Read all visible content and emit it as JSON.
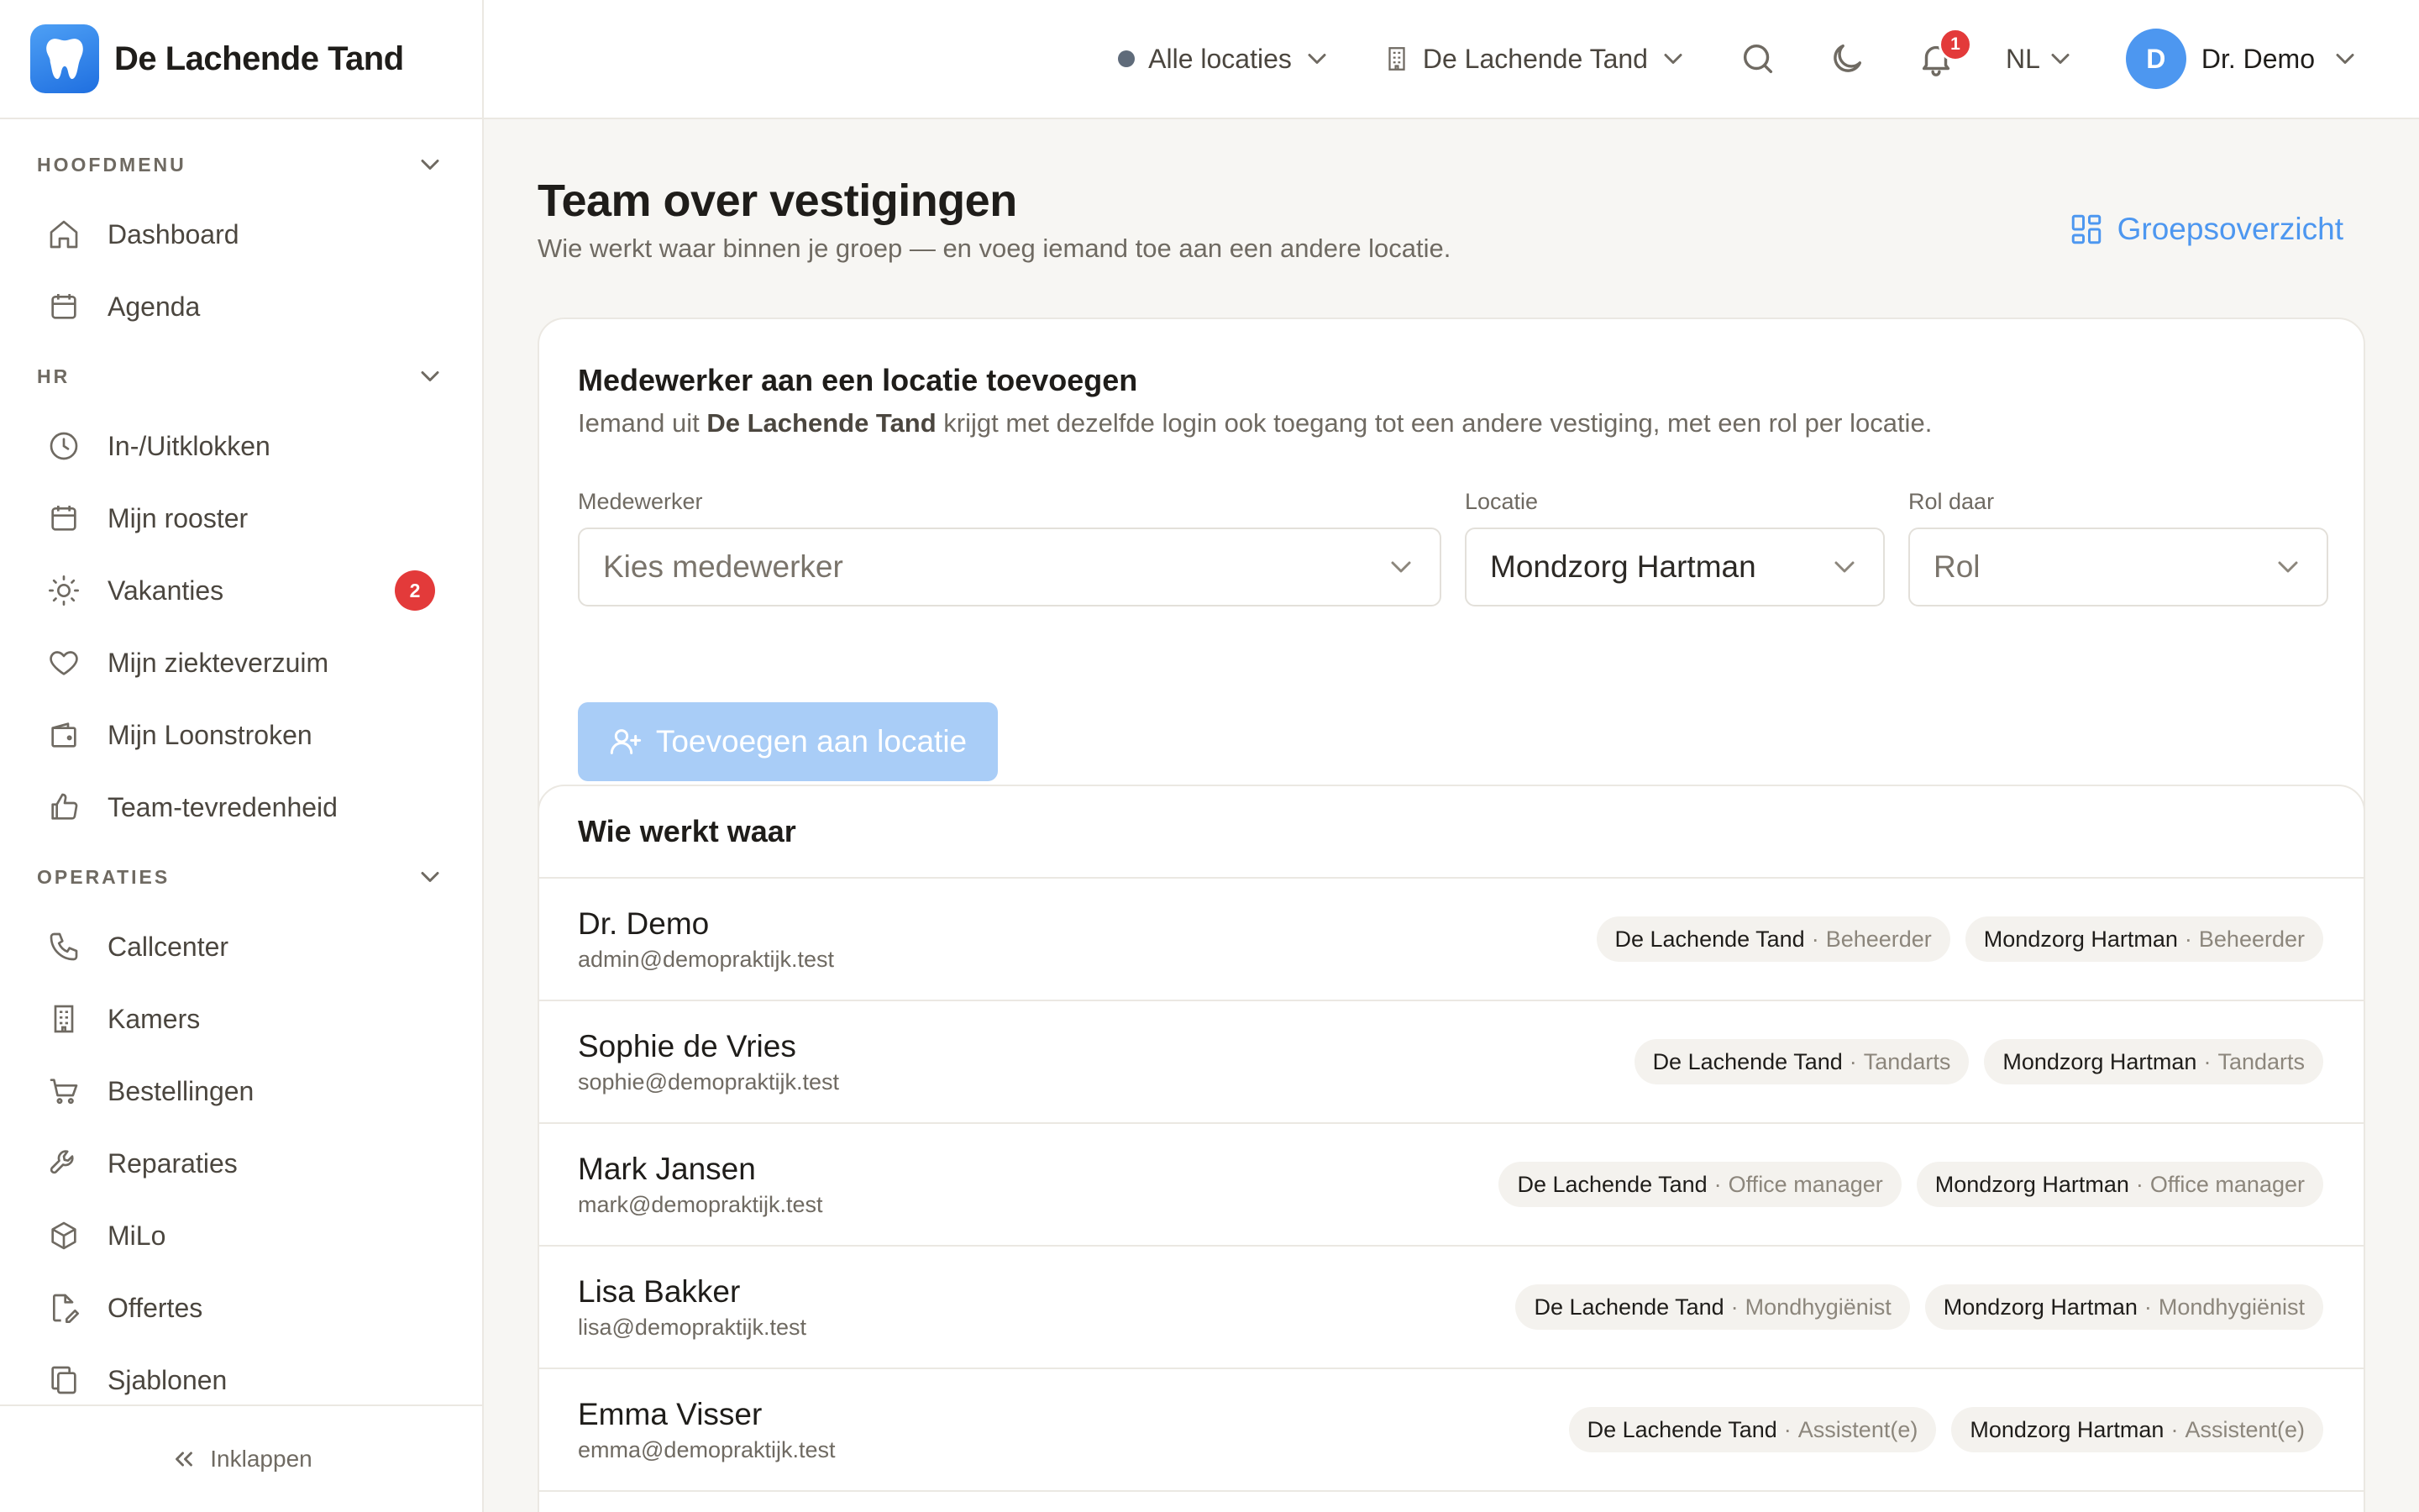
{
  "brand": {
    "name": "De Lachende Tand"
  },
  "sidebar": {
    "sections": [
      {
        "title": "HOOFDMENU",
        "items": [
          {
            "label": "Dashboard",
            "icon": "home-icon"
          },
          {
            "label": "Agenda",
            "icon": "calendar-icon"
          }
        ]
      },
      {
        "title": "HR",
        "items": [
          {
            "label": "In-/Uitklokken",
            "icon": "clock-icon"
          },
          {
            "label": "Mijn rooster",
            "icon": "calendar-icon"
          },
          {
            "label": "Vakanties",
            "icon": "sun-icon",
            "badge": "2"
          },
          {
            "label": "Mijn ziekteverzuim",
            "icon": "heart-icon"
          },
          {
            "label": "Mijn Loonstroken",
            "icon": "wallet-icon"
          },
          {
            "label": "Team-tevredenheid",
            "icon": "thumbs-up-icon"
          }
        ]
      },
      {
        "title": "OPERATIES",
        "items": [
          {
            "label": "Callcenter",
            "icon": "phone-icon"
          },
          {
            "label": "Kamers",
            "icon": "building-icon"
          },
          {
            "label": "Bestellingen",
            "icon": "cart-icon"
          },
          {
            "label": "Reparaties",
            "icon": "wrench-icon"
          },
          {
            "label": "MiLo",
            "icon": "box-icon"
          },
          {
            "label": "Offertes",
            "icon": "file-edit-icon"
          },
          {
            "label": "Sjablonen",
            "icon": "copy-icon"
          }
        ]
      }
    ],
    "collapse_label": "Inklappen"
  },
  "topbar": {
    "locations_label": "Alle locaties",
    "practice_label": "De Lachende Tand",
    "notifications_count": "1",
    "language": "NL",
    "user_initial": "D",
    "user_name": "Dr. Demo"
  },
  "page": {
    "title": "Team over vestigingen",
    "subtitle": "Wie werkt waar binnen je groep — en voeg iemand toe aan een andere locatie.",
    "group_link": "Groepsoverzicht"
  },
  "add_card": {
    "title": "Medewerker aan een locatie toevoegen",
    "desc_prefix": "Iemand uit ",
    "desc_bold": "De Lachende Tand",
    "desc_suffix": " krijgt met dezelfde login ook toegang tot een andere vestiging, met een rol per locatie.",
    "employee_label": "Medewerker",
    "employee_placeholder": "Kies medewerker",
    "location_label": "Locatie",
    "location_value": "Mondzorg Hartman",
    "role_label": "Rol daar",
    "role_placeholder": "Rol",
    "button_label": "Toevoegen aan locatie"
  },
  "list_card": {
    "title": "Wie werkt waar",
    "rows": [
      {
        "name": "Dr. Demo",
        "email": "admin@demopraktijk.test",
        "assignments": [
          {
            "location": "De Lachende Tand",
            "role": "Beheerder"
          },
          {
            "location": "Mondzorg Hartman",
            "role": "Beheerder"
          }
        ]
      },
      {
        "name": "Sophie de Vries",
        "email": "sophie@demopraktijk.test",
        "assignments": [
          {
            "location": "De Lachende Tand",
            "role": "Tandarts"
          },
          {
            "location": "Mondzorg Hartman",
            "role": "Tandarts"
          }
        ]
      },
      {
        "name": "Mark Jansen",
        "email": "mark@demopraktijk.test",
        "assignments": [
          {
            "location": "De Lachende Tand",
            "role": "Office manager"
          },
          {
            "location": "Mondzorg Hartman",
            "role": "Office manager"
          }
        ]
      },
      {
        "name": "Lisa Bakker",
        "email": "lisa@demopraktijk.test",
        "assignments": [
          {
            "location": "De Lachende Tand",
            "role": "Mondhygiënist"
          },
          {
            "location": "Mondzorg Hartman",
            "role": "Mondhygiënist"
          }
        ]
      },
      {
        "name": "Emma Visser",
        "email": "emma@demopraktijk.test",
        "assignments": [
          {
            "location": "De Lachende Tand",
            "role": "Assistent(e)"
          },
          {
            "location": "Mondzorg Hartman",
            "role": "Assistent(e)"
          }
        ]
      }
    ]
  },
  "colors": {
    "accent": "#4d97f0",
    "badge": "#e33a3a",
    "button_disabled": "#a9cdf7"
  }
}
